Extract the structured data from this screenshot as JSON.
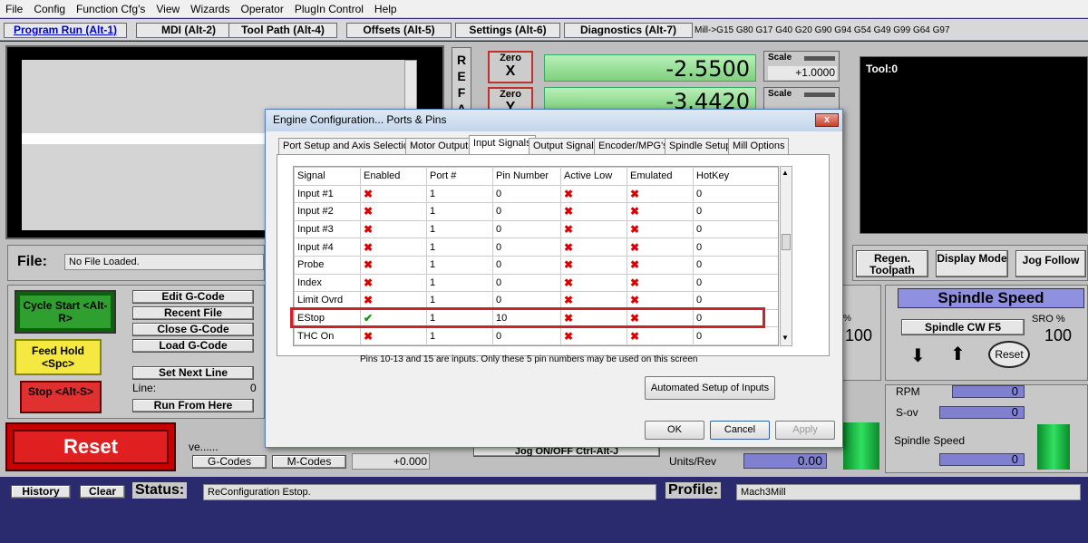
{
  "menu": [
    "File",
    "Config",
    "Function Cfg's",
    "View",
    "Wizards",
    "Operator",
    "PlugIn Control",
    "Help"
  ],
  "main_tabs": [
    {
      "label": "Program Run (Alt-1)",
      "active": true
    },
    {
      "label": "MDI (Alt-2)"
    },
    {
      "label": "Tool Path (Alt-4)"
    },
    {
      "label": "Offsets (Alt-5)"
    },
    {
      "label": "Settings (Alt-6)"
    },
    {
      "label": "Diagnostics (Alt-7)"
    }
  ],
  "modal_gcodes": "Mill->G15  G80 G17 G40 G20 G90 G94 G54 G49 G99 G64 G97",
  "ref_label": "R E F A",
  "zero_x": {
    "top": "Zero",
    "bottom": "X"
  },
  "zero_y": {
    "top": "Zero",
    "bottom": "Y"
  },
  "dro_x": "-2.5500",
  "dro_y": "-3.4420",
  "scale_label": "Scale",
  "scale_x": "+1.0000",
  "tool_label": "Tool:0",
  "file": {
    "label": "File:",
    "value": "No File Loaded."
  },
  "buttons": {
    "cycle_start": "Cycle Start <Alt-R>",
    "feed_hold": "Feed Hold <Spc>",
    "stop": "Stop <Alt-S>",
    "reset": "Reset",
    "edit_gcode": "Edit G-Code",
    "recent_file": "Recent File",
    "close_gcode": "Close G-Code",
    "load_gcode": "Load G-Code",
    "set_next_line": "Set Next Line",
    "run_from_here": "Run From Here",
    "gcodes": "G-Codes",
    "mcodes": "M-Codes",
    "jog": "Jog ON/OFF Ctrl-Alt-J",
    "regen": "Regen. Toolpath",
    "display_mode": "Display Mode",
    "jog_follow": "Jog Follow",
    "spindle_cw": "Spindle CW F5",
    "spindle_reset": "Reset",
    "history": "History",
    "clear": "Clear"
  },
  "line_label": "Line:",
  "line_value": "0",
  "ve_label": "ve......",
  "feed_small": "+0.000",
  "units_rev": "Units/Rev",
  "units_rev_val": "0.00",
  "pct": "%",
  "feed_pct_val": "100",
  "spindle": {
    "title": "Spindle Speed",
    "sro": "SRO %",
    "sro_val": "100",
    "rpm_label": "RPM",
    "rpm_val": "0",
    "sov_label": "S-ov",
    "sov_val": "0",
    "speed_label": "Spindle Speed",
    "speed_val": "0"
  },
  "status": {
    "label": "Status:",
    "value": "ReConfiguration Estop."
  },
  "profile": {
    "label": "Profile:",
    "value": "Mach3Mill"
  },
  "dialog": {
    "title": "Engine Configuration... Ports & Pins",
    "close": "x",
    "tabs": [
      {
        "label": "Port Setup and Axis Selection"
      },
      {
        "label": "Motor Outputs"
      },
      {
        "label": "Input Signals",
        "active": true
      },
      {
        "label": "Output Signals"
      },
      {
        "label": "Encoder/MPG's"
      },
      {
        "label": "Spindle Setup"
      },
      {
        "label": "Mill Options"
      }
    ],
    "columns": [
      "Signal",
      "Enabled",
      "Port #",
      "Pin Number",
      "Active Low",
      "Emulated",
      "HotKey"
    ],
    "rows": [
      [
        "Input #1",
        "x",
        "1",
        "0",
        "x",
        "x",
        "0"
      ],
      [
        "Input #2",
        "x",
        "1",
        "0",
        "x",
        "x",
        "0"
      ],
      [
        "Input #3",
        "x",
        "1",
        "0",
        "x",
        "x",
        "0"
      ],
      [
        "Input #4",
        "x",
        "1",
        "0",
        "x",
        "x",
        "0"
      ],
      [
        "Probe",
        "x",
        "1",
        "0",
        "x",
        "x",
        "0"
      ],
      [
        "Index",
        "x",
        "1",
        "0",
        "x",
        "x",
        "0"
      ],
      [
        "Limit Ovrd",
        "x",
        "1",
        "0",
        "x",
        "x",
        "0"
      ],
      [
        "EStop",
        "check",
        "1",
        "10",
        "x",
        "x",
        "0"
      ],
      [
        "THC On",
        "x",
        "1",
        "0",
        "x",
        "x",
        "0"
      ]
    ],
    "note": "Pins 10-13 and 15 are inputs. Only these 5 pin numbers may be used on this screen",
    "auto_setup": "Automated Setup of Inputs",
    "ok": "OK",
    "cancel": "Cancel",
    "apply": "Apply"
  },
  "colors": {
    "accent_red": "#d0202a",
    "dro_green": "#90e090",
    "bg_blue": "#2a2a6e"
  }
}
